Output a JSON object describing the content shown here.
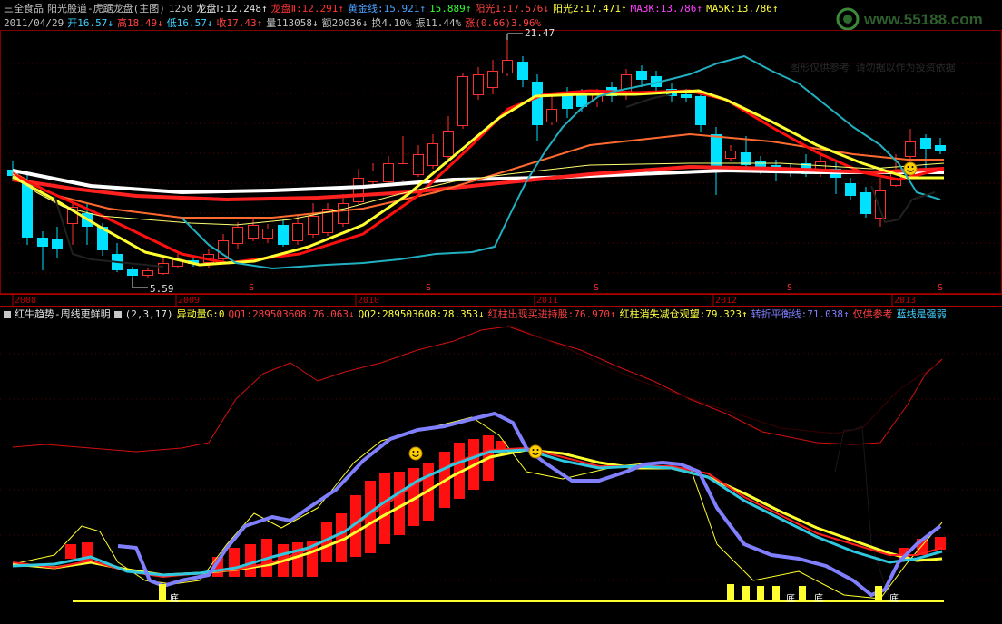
{
  "header": {
    "line1": [
      {
        "text": "三全食品",
        "color": "#c0c0c0"
      },
      {
        "text": "阳光股道-虎踞龙盘(主图)",
        "color": "#c0c0c0"
      },
      {
        "text": "1250",
        "color": "#c0c0c0"
      },
      {
        "text": "龙盘Ⅰ:12.248↑",
        "color": "#e0e0e0"
      },
      {
        "text": "龙盘Ⅱ:12.291↑",
        "color": "#ff3030"
      },
      {
        "text": "黄金线:15.921↑",
        "color": "#4aa0ff"
      },
      {
        "text": "15.889↑",
        "color": "#30ff30"
      },
      {
        "text": "阳光1:17.576↓",
        "color": "#ff4040"
      },
      {
        "text": "阳光2:17.471↑",
        "color": "#ffff40"
      },
      {
        "text": "MA3K:13.786↑",
        "color": "#ff40ff"
      },
      {
        "text": "MA5K:13.786↑",
        "color": "#ffff40"
      }
    ],
    "line2": [
      {
        "text": "2011/04/29",
        "color": "#c0c0c0"
      },
      {
        "text": "开16.57↓",
        "color": "#40d0ff"
      },
      {
        "text": "高18.49↓",
        "color": "#ff4040"
      },
      {
        "text": "低16.57↓",
        "color": "#40d0ff"
      },
      {
        "text": "收17.43↑",
        "color": "#ff4040"
      },
      {
        "text": "量113058↓",
        "color": "#c0c0c0"
      },
      {
        "text": "额20036↓",
        "color": "#c0c0c0"
      },
      {
        "text": "换4.10%",
        "color": "#c0c0c0"
      },
      {
        "text": "振11.44%",
        "color": "#c0c0c0"
      },
      {
        "text": "涨(0.66)3.96%",
        "color": "#ff4040"
      }
    ],
    "watermark": "www.55188.com",
    "faded_text": "图形仅供参考 请勿据以作为投资依据"
  },
  "price_labels": {
    "high": "21.47",
    "low": "5.59"
  },
  "years": [
    "2008",
    "2009",
    "2010",
    "2011",
    "2012",
    "2013"
  ],
  "dividend_marker": "S",
  "indicator": {
    "line": [
      {
        "text": "红牛趋势-周线更鲜明",
        "color": "#e0e0e0",
        "check": true
      },
      {
        "text": "(2,3,17)",
        "color": "#e0e0e0",
        "check": true
      },
      {
        "text": "异动量G:0",
        "color": "#ffff40",
        "check": false
      },
      {
        "text": "QQ1:289503608:76.063↓",
        "color": "#ff4040",
        "check": false
      },
      {
        "text": "QQ2:289503608:78.353↓",
        "color": "#ffff40",
        "check": false
      },
      {
        "text": "红柱出现买进持股:76.970↑",
        "color": "#ff4040",
        "check": false
      },
      {
        "text": "红柱消失减仓观望:79.323↑",
        "color": "#ffff40",
        "check": false
      },
      {
        "text": "转折平衡线:71.038↑",
        "color": "#8080ff",
        "check": false
      },
      {
        "text": "仅供参考",
        "color": "#ff4040",
        "check": false
      },
      {
        "text": "蓝线是强弱",
        "color": "#40d0ff",
        "check": false
      }
    ],
    "bottom_label": "底"
  }
}
